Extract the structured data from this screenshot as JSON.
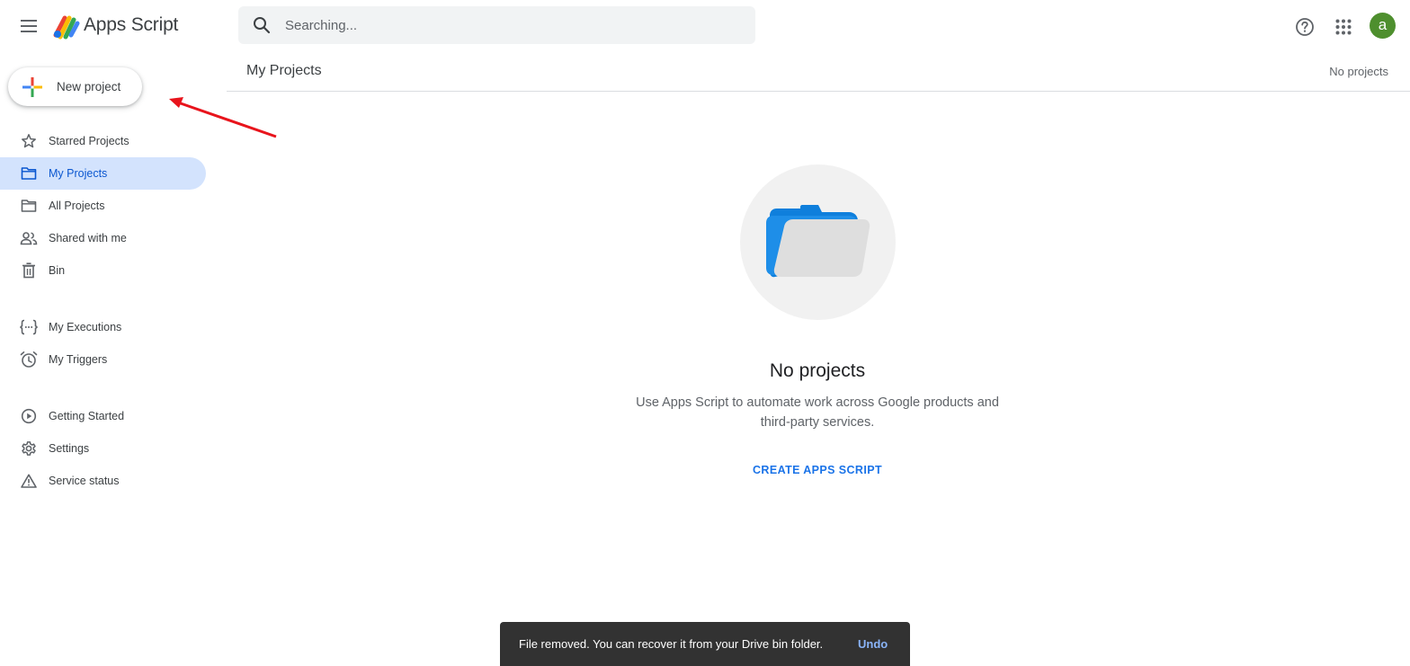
{
  "app": {
    "title": "Apps Script"
  },
  "search": {
    "placeholder": "Searching..."
  },
  "header": {
    "avatar_letter": "a"
  },
  "sidebar": {
    "new_project_label": "New project",
    "items": [
      {
        "label": "Starred Projects",
        "icon": "star-icon"
      },
      {
        "label": "My Projects",
        "icon": "folder-icon",
        "active": true
      },
      {
        "label": "All Projects",
        "icon": "folder-icon"
      },
      {
        "label": "Shared with me",
        "icon": "people-icon"
      },
      {
        "label": "Bin",
        "icon": "trash-icon"
      },
      {
        "label": "My Executions",
        "icon": "executions-icon"
      },
      {
        "label": "My Triggers",
        "icon": "alarm-icon"
      },
      {
        "label": "Getting Started",
        "icon": "play-circle-icon"
      },
      {
        "label": "Settings",
        "icon": "gear-icon"
      },
      {
        "label": "Service status",
        "icon": "warning-icon"
      }
    ]
  },
  "main": {
    "title": "My Projects",
    "count_label": "No projects",
    "empty_state": {
      "heading": "No projects",
      "description": "Use Apps Script to automate work across Google products and third-party services.",
      "cta": "CREATE APPS SCRIPT"
    }
  },
  "snackbar": {
    "message": "File removed. You can recover it from your Drive bin folder.",
    "action": "Undo"
  },
  "colors": {
    "accent": "#1a73e8",
    "active_nav_bg": "#d3e3fd",
    "avatar_bg": "#4e8f2e",
    "annotation_arrow": "#e8141c",
    "snackbar_bg": "#323232"
  }
}
